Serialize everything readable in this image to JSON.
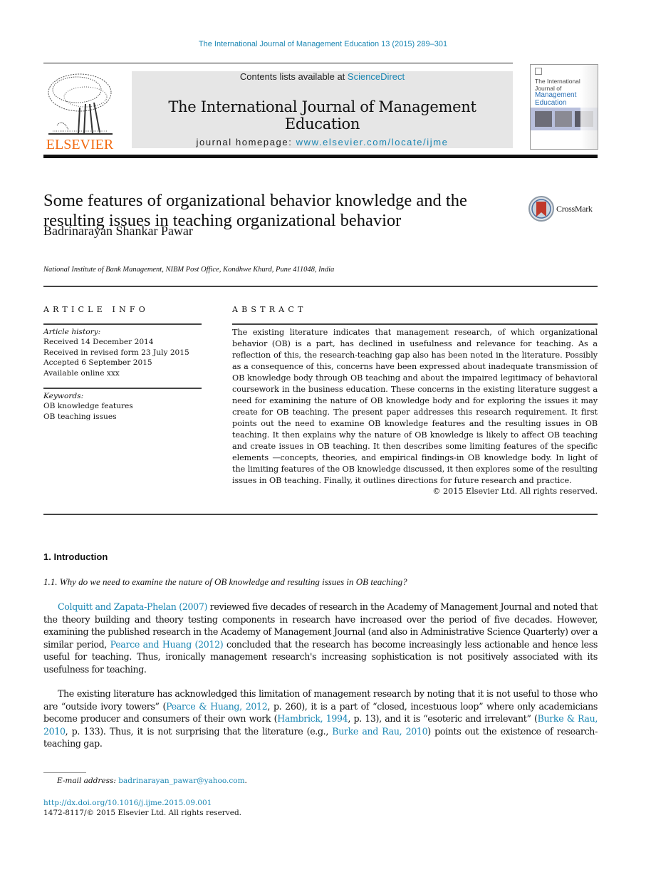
{
  "running_head": "The International Journal of Management Education 13 (2015) 289–301",
  "masthead": {
    "publisher_logo_text": "ELSEVIER",
    "contents_prefix": "Contents lists available at ",
    "contents_link": "ScienceDirect",
    "journal_name": "The International Journal of Management Education",
    "homepage_prefix": "journal homepage: ",
    "homepage_link": "www.elsevier.com/locate/ijme",
    "cover_lines": [
      "The International",
      "Journal of",
      "Management",
      "Education"
    ],
    "colors": {
      "link": "#1a86b3",
      "elsevier_orange": "#f26b12",
      "masthead_bg": "#e6e6e6"
    }
  },
  "article": {
    "title": "Some features of organizational behavior knowledge and the resulting issues in teaching organizational behavior",
    "crossmark_label": "CrossMark",
    "author": "Badrinarayan Shankar Pawar",
    "affiliation": "National Institute of Bank Management, NIBM Post Office, Kondhwe Khurd, Pune 411048, India"
  },
  "article_info": {
    "heading": "ARTICLE INFO",
    "history_label": "Article history:",
    "history": [
      "Received 14 December 2014",
      "Received in revised form 23 July 2015",
      "Accepted 6 September 2015",
      "Available online xxx"
    ],
    "keywords_label": "Keywords:",
    "keywords": [
      "OB knowledge features",
      "OB teaching issues"
    ]
  },
  "abstract": {
    "heading": "ABSTRACT",
    "text": "The existing literature indicates that management research, of which organizational behavior (OB) is a part, has declined in usefulness and relevance for teaching. As a reflection of this, the research-teaching gap also has been noted in the literature. Possibly as a consequence of this, concerns have been expressed about inadequate transmission of OB knowledge body through OB teaching and about the impaired legitimacy of behavioral coursework in the business education. These concerns in the existing literature suggest a need for examining the nature of OB knowledge body and for exploring the issues it may create for OB teaching. The present paper addresses this research requirement. It first points out the need to examine OB knowledge features and the resulting issues in OB teaching. It then explains why the nature of OB knowledge is likely to affect OB teaching and create issues in OB teaching. It then describes some limiting features of the specific elements —concepts, theories, and empirical findings-in OB knowledge body. In light of the limiting features of the OB knowledge discussed, it then explores some of the resulting issues in OB teaching. Finally, it outlines directions for future research and practice.",
    "copyright": "© 2015 Elsevier Ltd. All rights reserved."
  },
  "body": {
    "section_heading": "1.  Introduction",
    "subsection_heading": "1.1.  Why do we need to examine the nature of OB knowledge and resulting issues in OB teaching?",
    "para1": {
      "cite1": "Colquitt and Zapata-Phelan (2007)",
      "t1": " reviewed five decades of research in the Academy of Management Journal and noted that the theory building and theory testing components in research have increased over the period of five decades. However, examining the published research in the Academy of Management Journal (and also in Administrative Science Quarterly) over a similar period, ",
      "cite2": "Pearce and Huang (2012)",
      "t2": " concluded that the research has become increasingly less actionable and hence less useful for teaching. Thus, ironically management research's increasing sophistication is not positively associated with its usefulness for teaching."
    },
    "para2": {
      "t1": "The existing literature has acknowledged this limitation of management research by noting that it is not useful to those who are “outside ivory towers” (",
      "cite1": "Pearce & Huang, 2012",
      "t2": ", p. 260), it is a part of “closed, incestuous loop” where only academicians become producer and consumers of their own work (",
      "cite2": "Hambrick, 1994",
      "t3": ", p. 13), and it is “esoteric and irrelevant” (",
      "cite3": "Burke & Rau, 2010",
      "t4": ", p. 133). Thus, it is not surprising that the literature (e.g., ",
      "cite4": "Burke and Rau, 2010",
      "t5": ") points out the existence of research-teaching gap."
    }
  },
  "footer": {
    "email_label": "E-mail address: ",
    "email": "badrinarayan_pawar@yahoo.com",
    "email_suffix": ".",
    "doi": "http://dx.doi.org/10.1016/j.ijme.2015.09.001",
    "issn_line": "1472-8117/© 2015 Elsevier Ltd. All rights reserved."
  }
}
